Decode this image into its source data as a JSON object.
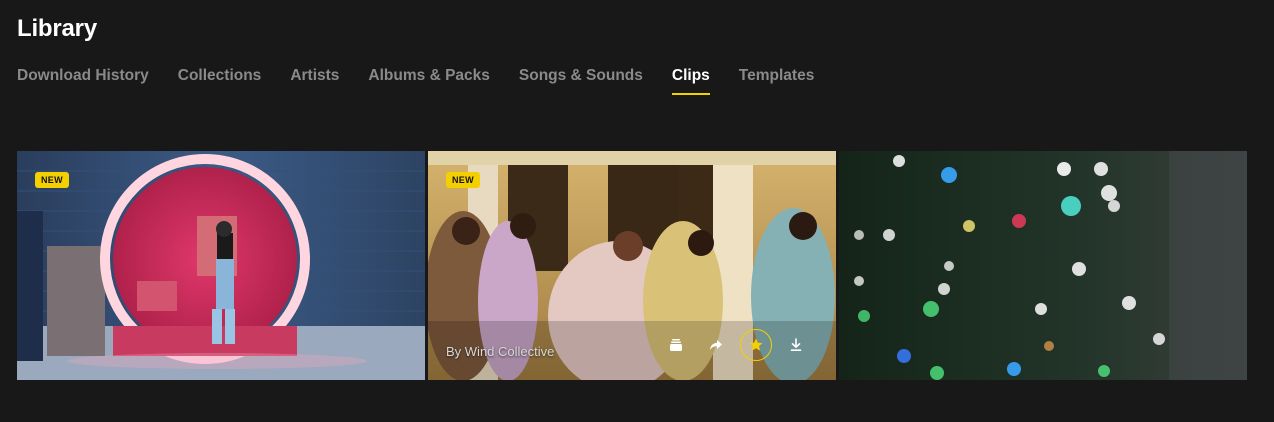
{
  "header": {
    "title": "Library"
  },
  "tabs": [
    {
      "label": "Download History",
      "active": false
    },
    {
      "label": "Collections",
      "active": false
    },
    {
      "label": "Artists",
      "active": false
    },
    {
      "label": "Albums & Packs",
      "active": false
    },
    {
      "label": "Songs & Sounds",
      "active": false
    },
    {
      "label": "Clips",
      "active": true
    },
    {
      "label": "Templates",
      "active": false
    }
  ],
  "clips": [
    {
      "badge": "NEW",
      "scene": "vr-headset-neon-arch"
    },
    {
      "badge": "NEW",
      "scene": "dancers-festive",
      "byline": "By Wind Collective",
      "actions": [
        "collection-icon",
        "share-icon",
        "favorite-star-icon",
        "download-icon"
      ]
    },
    {
      "scene": "christmas-tree-bokeh"
    }
  ],
  "colors": {
    "accent": "#f5d000",
    "background": "#181818",
    "tab_inactive": "#8a8a8a"
  }
}
